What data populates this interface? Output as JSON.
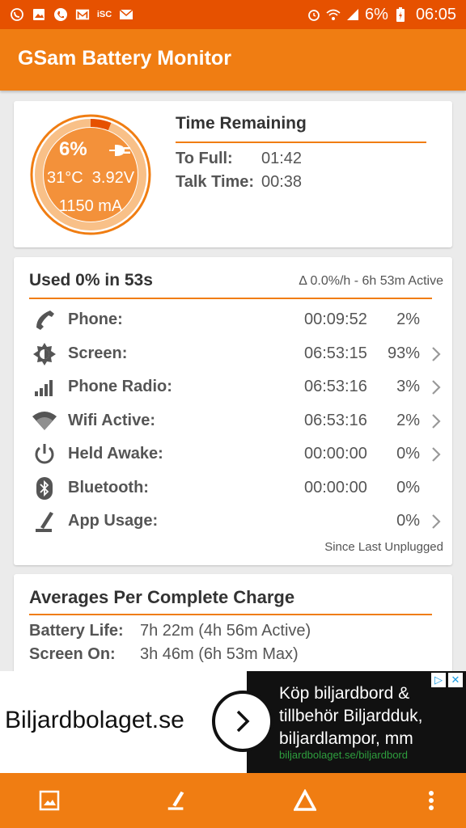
{
  "status_bar": {
    "battery_percent": "6%",
    "time": "06:05",
    "icons": [
      "whatsapp-icon",
      "gallery-icon",
      "phone-icon",
      "gmail-icon",
      "isc-icon",
      "mail-icon",
      "alarm-icon",
      "wifi-icon",
      "signal-icon",
      "battery-charging-icon"
    ]
  },
  "app": {
    "title": "GSam Battery Monitor"
  },
  "gauge": {
    "percent": "6%",
    "level": 0.06,
    "temperature": "31°C",
    "voltage": "3.92V",
    "current": "1150 mA",
    "color": "#f07d12"
  },
  "time_remaining": {
    "title": "Time Remaining",
    "rows": [
      {
        "label": "To Full:",
        "value": "01:42"
      },
      {
        "label": "Talk Time:",
        "value": "00:38"
      }
    ]
  },
  "usage": {
    "title": "Used 0% in 53s",
    "delta": "Δ 0.0%/h - 6h 53m Active",
    "rows": [
      {
        "icon": "phone-icon",
        "label": "Phone:",
        "time": "00:09:52",
        "percent": "2%",
        "chevron": false
      },
      {
        "icon": "screen-brightness-icon",
        "label": "Screen:",
        "time": "06:53:15",
        "percent": "93%",
        "chevron": true
      },
      {
        "icon": "signal-bars-icon",
        "label": "Phone Radio:",
        "time": "06:53:16",
        "percent": "3%",
        "chevron": true
      },
      {
        "icon": "wifi-icon",
        "label": "Wifi Active:",
        "time": "06:53:16",
        "percent": "2%",
        "chevron": true
      },
      {
        "icon": "power-icon",
        "label": "Held Awake:",
        "time": "00:00:00",
        "percent": "0%",
        "chevron": true
      },
      {
        "icon": "bluetooth-icon",
        "label": "Bluetooth:",
        "time": "00:00:00",
        "percent": "0%",
        "chevron": false
      },
      {
        "icon": "app-usage-icon",
        "label": "App Usage:",
        "time": "",
        "percent": "0%",
        "chevron": true
      }
    ],
    "footer": "Since Last Unplugged"
  },
  "averages": {
    "title": "Averages Per Complete Charge",
    "rows": [
      {
        "label": "Battery Life:",
        "value": "7h 22m (4h 56m Active)"
      },
      {
        "label": "Screen On:",
        "value": "3h 46m (6h 53m Max)"
      }
    ]
  },
  "ad": {
    "brand": "Biljardbolaget.se",
    "text": "Köp biljardbord & tillbehör Biljardduk, biljardlampor, mm",
    "url": "biljardbolaget.se/biljardbord"
  },
  "bottom_bar": {
    "buttons": [
      "image-icon",
      "app-usage-icon",
      "delta-icon",
      "more-vert-icon"
    ]
  }
}
